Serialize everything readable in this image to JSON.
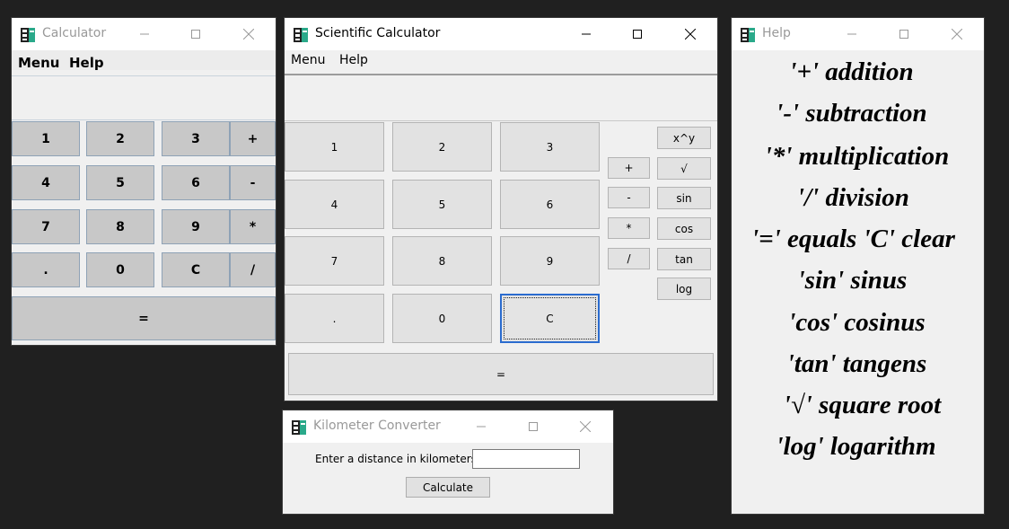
{
  "calculator": {
    "title": "Calculator",
    "menu": [
      "Menu",
      "Help"
    ],
    "rows": [
      [
        "1",
        "2",
        "3",
        "+"
      ],
      [
        "4",
        "5",
        "6",
        "-"
      ],
      [
        "7",
        "8",
        "9",
        "*"
      ],
      [
        ".",
        "0",
        "C",
        "/"
      ]
    ],
    "equals": "="
  },
  "scientific": {
    "title": "Scientific Calculator",
    "menu": [
      "Menu",
      "Help"
    ],
    "digits": [
      [
        "1",
        "2",
        "3"
      ],
      [
        "4",
        "5",
        "6"
      ],
      [
        "7",
        "8",
        "9"
      ],
      [
        ".",
        "0",
        "C"
      ]
    ],
    "operators": [
      "+",
      "-",
      "*",
      "/"
    ],
    "functions": [
      "x^y",
      "√",
      "sin",
      "cos",
      "tan",
      "log"
    ],
    "equals": "="
  },
  "help": {
    "title": "Help",
    "lines": [
      "'+' addition",
      "'-' subtraction",
      "'*' multiplication",
      "'/'  division",
      "'=' equals 'C' clear",
      "'sin' sinus",
      "'cos' cosinus",
      "'tan' tangens",
      "'√' square root",
      "'log' logarithm"
    ]
  },
  "converter": {
    "title": "Kilometer Converter",
    "prompt": "Enter a distance in kilometers",
    "input_value": "",
    "button": "Calculate"
  },
  "colors": {
    "desktop": "#202020",
    "focus_border": "#2b6ccf",
    "app_icon": "#2aa98a"
  }
}
